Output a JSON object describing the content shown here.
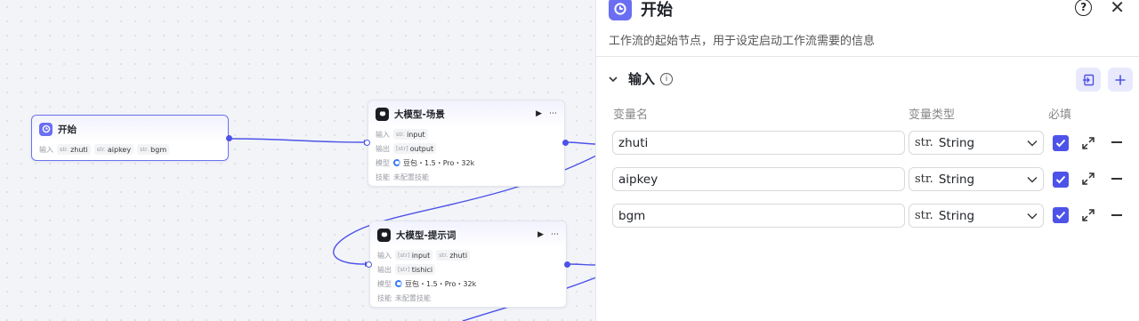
{
  "canvas": {
    "start_node": {
      "title": "开始",
      "input_label": "输入",
      "inputs": [
        {
          "type": "str.",
          "name": "zhuti"
        },
        {
          "type": "str.",
          "name": "aipkey"
        },
        {
          "type": "str.",
          "name": "bgm"
        }
      ]
    },
    "llm_scene": {
      "title": "大模型-场景",
      "input_label": "输入",
      "input_type": "str.",
      "input_name": "input",
      "output_label": "输出",
      "output_type": "[str]",
      "output_name": "output",
      "model_label": "模型",
      "model": "豆包・1.5・Pro・32k",
      "skill_label": "技能",
      "skill": "未配置技能"
    },
    "llm_prompt": {
      "title": "大模型-提示词",
      "input_label": "输入",
      "inputs": [
        {
          "type": "[str]",
          "name": "input"
        },
        {
          "type": "str.",
          "name": "zhuti"
        }
      ],
      "output_label": "输出",
      "output_type": "[str]",
      "output_name": "tishici",
      "model_label": "模型",
      "model": "豆包・1.5・Pro・32k",
      "skill_label": "技能",
      "skill": "未配置技能"
    },
    "icons": {
      "run": "play-icon",
      "more": "more-icon"
    }
  },
  "panel": {
    "title": "开始",
    "description": "工作流的起始节点，用于设定启动工作流需要的信息",
    "section_title": "输入",
    "columns": {
      "name": "变量名",
      "type": "变量类型",
      "required": "必填"
    },
    "variables": [
      {
        "name": "zhuti",
        "type_prefix": "str.",
        "type": "String",
        "required": true
      },
      {
        "name": "aipkey",
        "type_prefix": "str.",
        "type": "String",
        "required": true
      },
      {
        "name": "bgm",
        "type_prefix": "str.",
        "type": "String",
        "required": true
      }
    ],
    "accent": "#4d53e8"
  }
}
